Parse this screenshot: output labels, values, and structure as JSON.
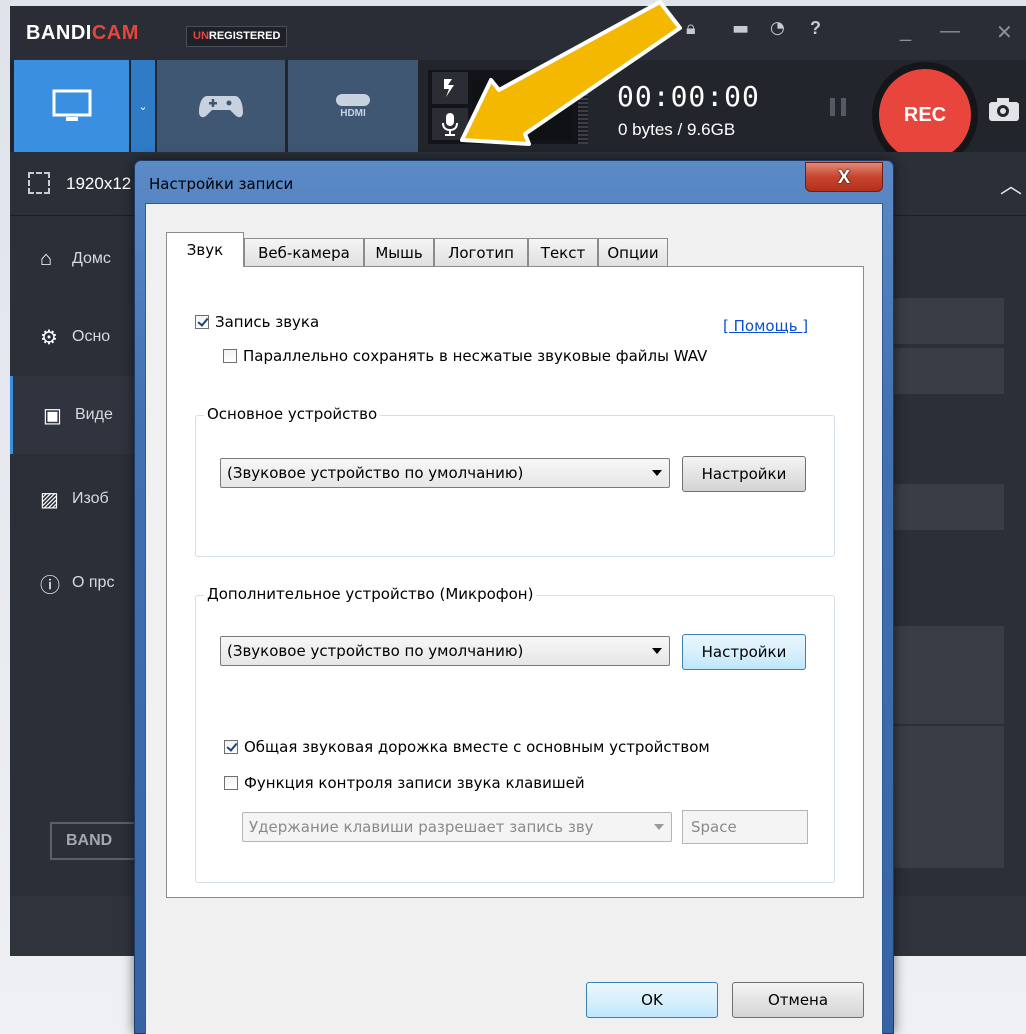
{
  "app": {
    "logo_part1": "BANDI",
    "logo_part2": "CAM",
    "unregistered_part1": "UN",
    "unregistered_part2": "REGISTERED",
    "window_controls": {
      "minimize": "_",
      "restore": "—",
      "close": "✕"
    }
  },
  "recorder": {
    "timer": "00:00:00",
    "size": "0 bytes / 9.6GB",
    "rec_label": "REC",
    "hdmi_label": "HDMI"
  },
  "resolution": {
    "text": "1920x12"
  },
  "sidebar": {
    "items": [
      {
        "label": "Домс",
        "icon": "home-icon"
      },
      {
        "label": "Осно",
        "icon": "gear-icon"
      },
      {
        "label": "Виде",
        "icon": "video-settings-icon"
      },
      {
        "label": "Изоб",
        "icon": "image-settings-icon"
      },
      {
        "label": "О прс",
        "icon": "info-icon"
      }
    ],
    "banner": "BAND"
  },
  "dialog": {
    "title": "Настройки записи",
    "close_label": "X",
    "tabs": [
      "Звук",
      "Веб-камера",
      "Мышь",
      "Логотип",
      "Текст",
      "Опции"
    ],
    "active_tab": "Звук",
    "record_sound": {
      "label": "Запись звука",
      "checked": true
    },
    "help_link": "[ Помощь ]",
    "save_wav": {
      "label": "Параллельно сохранять в несжатые звуковые файлы WAV",
      "checked": false
    },
    "primary_device": {
      "legend": "Основное устройство",
      "value": "(Звуковое устройство по умолчанию)",
      "settings_label": "Настройки"
    },
    "secondary_device": {
      "legend": "Дополнительное устройство (Микрофон)",
      "value": "(Звуковое устройство по умолчанию)",
      "settings_label": "Настройки",
      "mix_track": {
        "label": "Общая звуковая дорожка вместе с основным устройством",
        "checked": true
      },
      "hotkey_control": {
        "label": "Функция контроля записи звука клавишей",
        "checked": false
      },
      "hotkey_mode": "Удержание клавиши разрешает запись зву",
      "hotkey": "Space"
    },
    "ok_label": "OK",
    "cancel_label": "Отмена"
  },
  "colors": {
    "accent": "#3a8fe0",
    "rec": "#e8453c",
    "annotation_arrow": "#f5b800"
  }
}
